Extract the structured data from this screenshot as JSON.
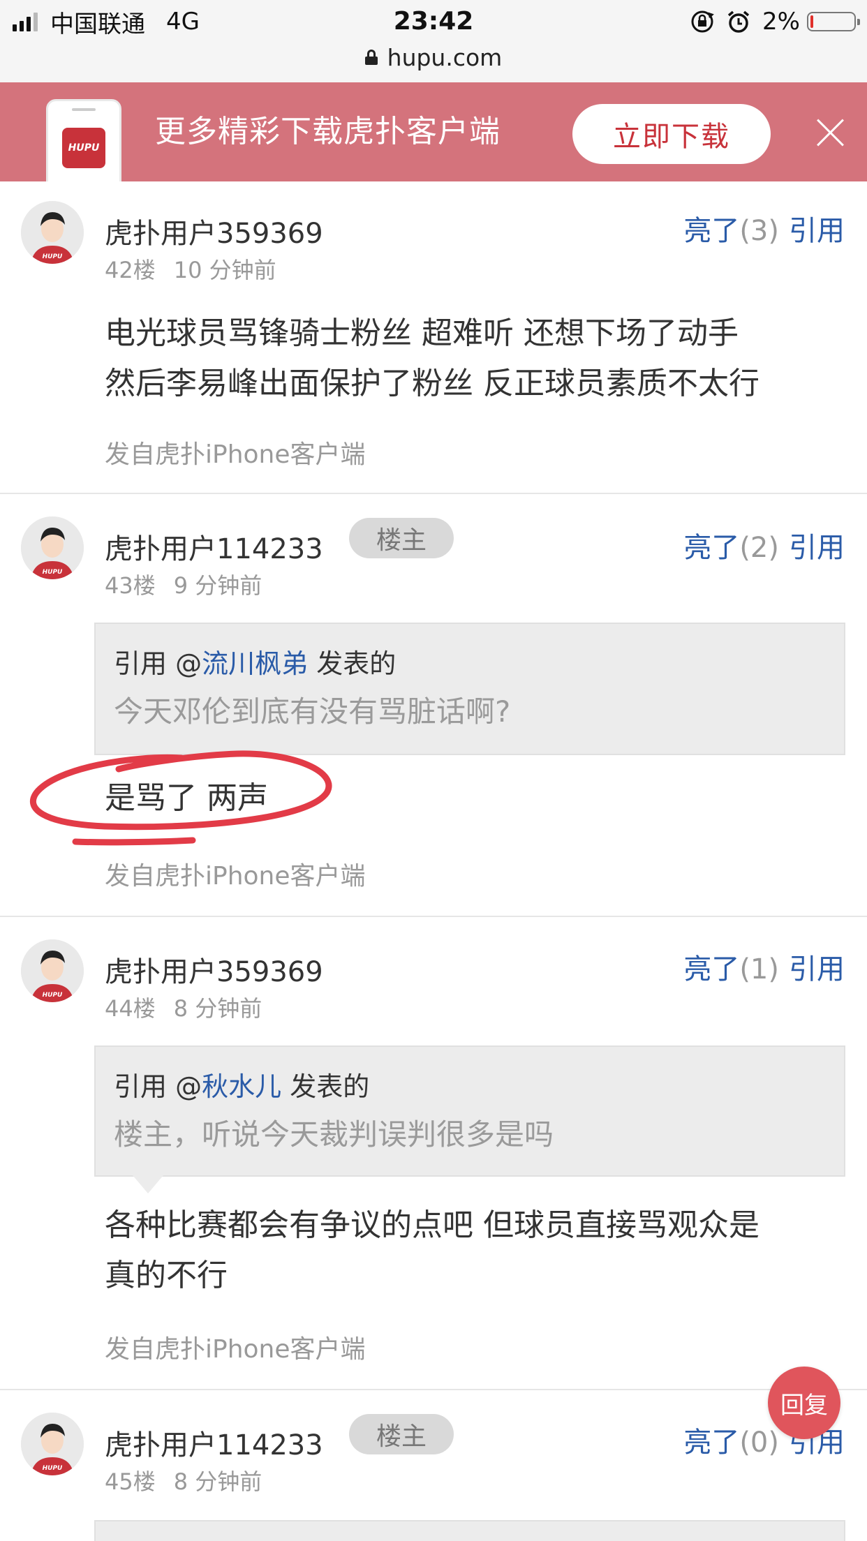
{
  "status_bar": {
    "carrier": "中国联通",
    "network": "4G",
    "time": "23:42",
    "battery": "2%",
    "url": "hupu.com",
    "icons": [
      "signal-icon",
      "rotation-lock-icon",
      "alarm-icon",
      "battery-icon",
      "lock-icon"
    ]
  },
  "banner": {
    "logo_text": "HUPU",
    "text": "更多精彩下载虎扑客户端",
    "button": "立即下载",
    "close_icon": "close-icon"
  },
  "posts": [
    {
      "user": "虎扑用户359369",
      "badge": "",
      "floor": "42楼",
      "time": "10 分钟前",
      "light_label": "亮了",
      "light_count": "(3)",
      "quote_label": "引用",
      "body_lines": [
        "电光球员骂锋骑士粉丝 超难听 还想下场了动手",
        "然后李易峰出面保护了粉丝 反正球员素质不太行"
      ],
      "source": "发自虎扑iPhone客户端"
    },
    {
      "user": "虎扑用户114233",
      "badge": "楼主",
      "floor": "43楼",
      "time": "9 分钟前",
      "light_label": "亮了",
      "light_count": "(2)",
      "quote_label": "引用",
      "quote": {
        "prefix": "引用 @",
        "user": "流川枫弟",
        "suffix": " 发表的",
        "text": "今天邓伦到底有没有骂脏话啊?"
      },
      "body_lines": [
        "是骂了 两声"
      ],
      "source": "发自虎扑iPhone客户端"
    },
    {
      "user": "虎扑用户359369",
      "badge": "",
      "floor": "44楼",
      "time": "8 分钟前",
      "light_label": "亮了",
      "light_count": "(1)",
      "quote_label": "引用",
      "quote": {
        "prefix": "引用 @",
        "user": "秋水儿",
        "suffix": " 发表的",
        "text": "楼主，听说今天裁判误判很多是吗"
      },
      "body_lines": [
        "各种比赛都会有争议的点吧 但球员直接骂观众是",
        "真的不行"
      ],
      "source": "发自虎扑iPhone客户端"
    },
    {
      "user": "虎扑用户114233",
      "badge": "楼主",
      "floor": "45楼",
      "time": "8 分钟前",
      "light_label": "亮了",
      "light_count": "(0)",
      "quote_label": "引用"
    }
  ],
  "reply_button": "回复",
  "colors": {
    "accent_blue": "#2a5ba8",
    "banner_pink": "#d4737c",
    "brand_red": "#c8323a",
    "fab_red": "#e0555c",
    "scribble_red": "#e23b47"
  }
}
